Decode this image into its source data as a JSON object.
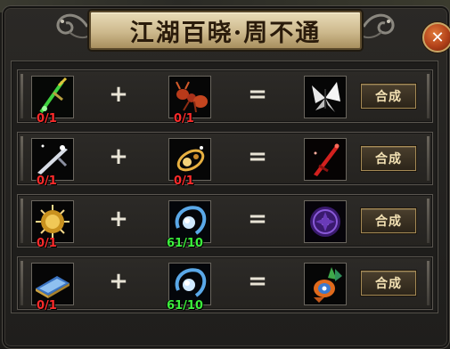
{
  "window": {
    "title": "江湖百晓·周不通",
    "close_symbol": "✕"
  },
  "operators": {
    "plus": "+",
    "equals": "="
  },
  "recipes": [
    {
      "ingredient_a": {
        "icon": "green-jade-sword-icon",
        "count": "0/1",
        "sufficient": false
      },
      "ingredient_b": {
        "icon": "red-ant-icon",
        "count": "0/1",
        "sufficient": false
      },
      "result": {
        "icon": "white-butterfly-icon"
      },
      "craft_label": "合成"
    },
    {
      "ingredient_a": {
        "icon": "silver-blade-icon",
        "count": "0/1",
        "sufficient": false
      },
      "ingredient_b": {
        "icon": "golden-ornament-icon",
        "count": "0/1",
        "sufficient": false
      },
      "result": {
        "icon": "crimson-sword-icon"
      },
      "craft_label": "合成"
    },
    {
      "ingredient_a": {
        "icon": "golden-medallion-icon",
        "count": "0/1",
        "sufficient": false
      },
      "ingredient_b": {
        "icon": "blue-orb-ring-icon",
        "count": "61/10",
        "sufficient": true
      },
      "result": {
        "icon": "purple-seal-icon"
      },
      "craft_label": "合成"
    },
    {
      "ingredient_a": {
        "icon": "blue-scroll-book-icon",
        "count": "0/1",
        "sufficient": false
      },
      "ingredient_b": {
        "icon": "blue-orb-ring-icon",
        "count": "61/10",
        "sufficient": true
      },
      "result": {
        "icon": "feathered-mask-icon"
      },
      "craft_label": "合成"
    }
  ],
  "colors": {
    "count_insufficient": "#ff2b2b",
    "count_sufficient": "#3cf03c",
    "title_plate": "#cdb98d",
    "close_button": "#b3421a"
  }
}
